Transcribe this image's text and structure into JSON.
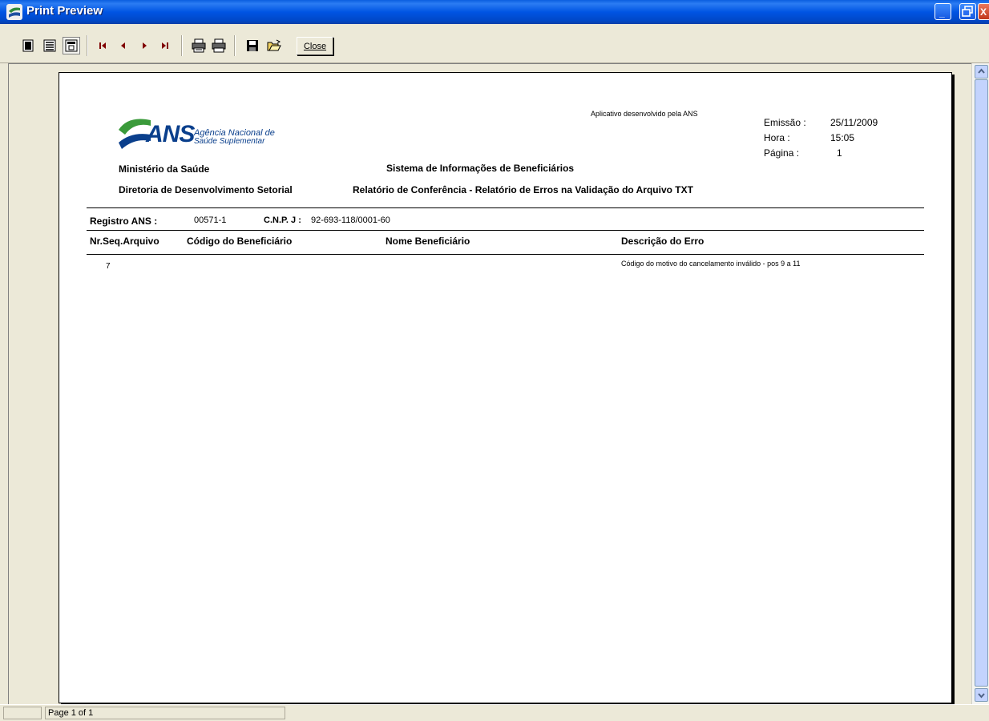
{
  "window": {
    "title": "Print Preview"
  },
  "toolbar": {
    "close_label": "Close"
  },
  "report": {
    "app_note": "Aplicativo desenvolvido pela ANS",
    "logo": {
      "name": "ANS",
      "line1": "Agência Nacional de",
      "line2": "Saúde Suplementar"
    },
    "meta": {
      "emissao_label": "Emissão :",
      "emissao_value": "25/11/2009",
      "hora_label": "Hora :",
      "hora_value": "15:05",
      "pagina_label": "Página :",
      "pagina_value": "1"
    },
    "org": {
      "ministerio": "Ministério da Saúde",
      "diretoria": "Diretoria de Desenvolvimento Setorial"
    },
    "system_title": "Sistema  de Informações de Beneficiários",
    "report_title": "Relatório de Conferência - Relatório de Erros na Validação do Arquivo TXT",
    "registro_label": "Registro ANS :",
    "registro_value": "00571-1",
    "cnpj_label": "C.N.P. J :",
    "cnpj_value": "92-693-118/0001-60",
    "columns": [
      "Nr.Seq.Arquivo",
      "Código do Beneficiário",
      "Nome Beneficiário",
      "Descrição do Erro"
    ],
    "rows": [
      {
        "seq": "7",
        "codigo": "",
        "nome": "",
        "descricao": "Código do motivo do cancelamento inválido - pos 9 a 11"
      }
    ]
  },
  "statusbar": {
    "page_text": "Page 1 of 1"
  },
  "colors": {
    "titlebar": "#0054e3",
    "window_bg": "#ece9d8",
    "logo_green": "#3a9a3a",
    "logo_blue": "#0a3f8c"
  }
}
